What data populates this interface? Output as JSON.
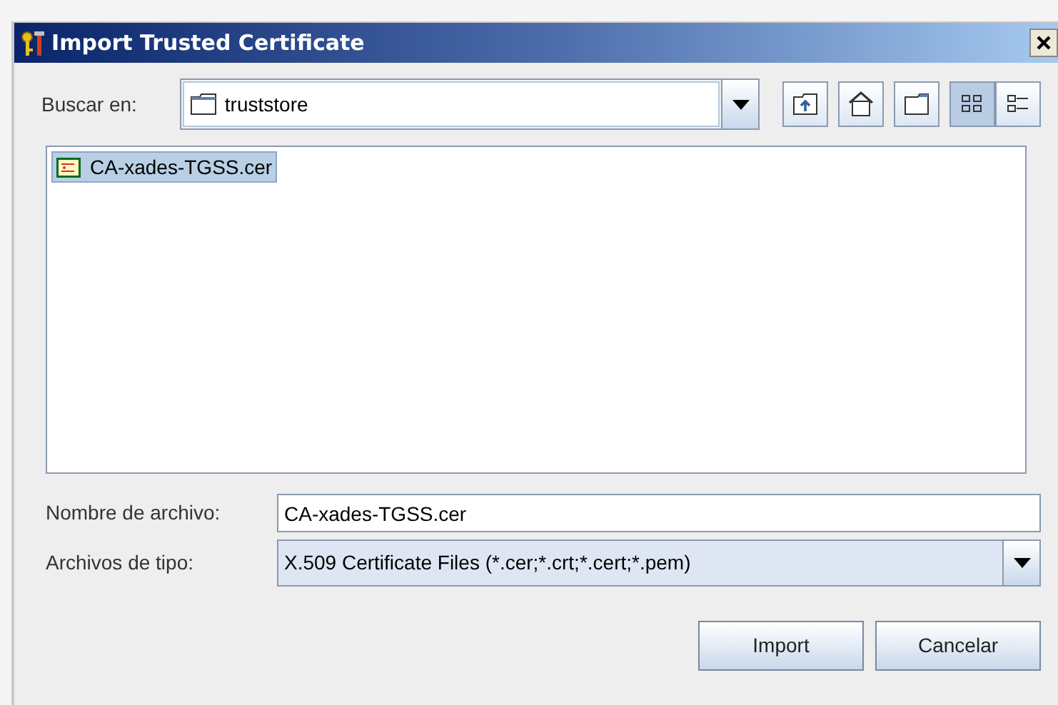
{
  "window": {
    "title": "Import Trusted Certificate"
  },
  "look_in": {
    "label": "Buscar en:",
    "value": "truststore"
  },
  "toolbar": [
    {
      "kind": "up"
    },
    {
      "kind": "home"
    },
    {
      "kind": "new-folder"
    },
    {
      "kind": "list",
      "selected": true
    },
    {
      "kind": "details",
      "selected": false
    }
  ],
  "files": [
    {
      "name": "CA-xades-TGSS.cer",
      "selected": true
    }
  ],
  "file_name": {
    "label": "Nombre de archivo:",
    "value": "CA-xades-TGSS.cer"
  },
  "file_type": {
    "label": "Archivos de tipo:",
    "value": "X.509 Certificate Files (*.cer;*.crt;*.cert;*.pem)"
  },
  "buttons": [
    "Import",
    "Cancelar"
  ]
}
